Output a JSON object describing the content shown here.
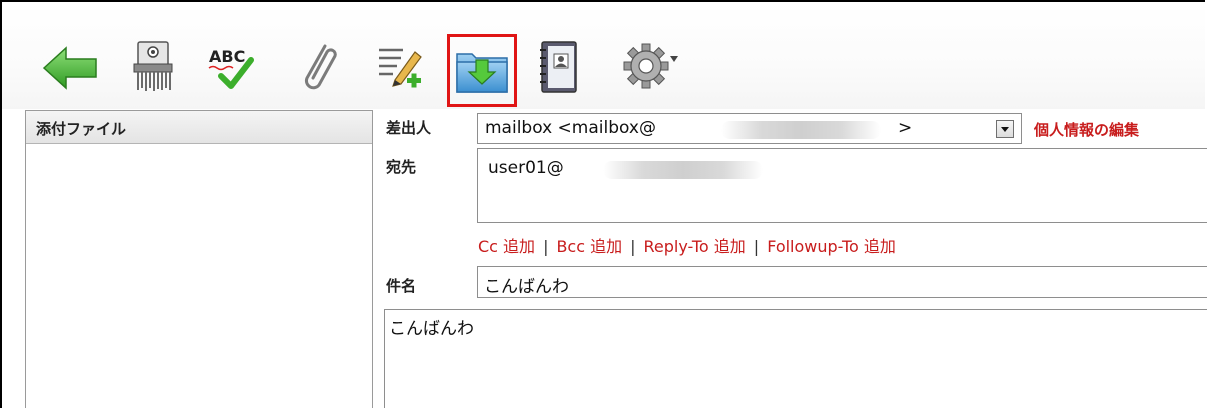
{
  "toolbar": {
    "buttons": [
      {
        "name": "back-arrow-icon"
      },
      {
        "name": "shredder-icon"
      },
      {
        "name": "spellcheck-icon",
        "text": "ABC"
      },
      {
        "name": "paperclip-icon"
      },
      {
        "name": "edit-add-icon"
      },
      {
        "name": "save-to-folder-icon"
      },
      {
        "name": "address-book-icon"
      },
      {
        "name": "gear-icon"
      }
    ],
    "colors": {
      "highlight": "#e01515",
      "arrow": "#3fb32f",
      "link": "#c81d1d"
    }
  },
  "attachments": {
    "header": "添付ファイル"
  },
  "compose": {
    "from_label": "差出人",
    "from_value_prefix": "mailbox <mailbox@",
    "from_value_suffix": ">",
    "edit_profile_link": "個人情報の編集",
    "to_label": "宛先",
    "to_value": "user01@",
    "add_links": [
      "Cc 追加",
      "Bcc 追加",
      "Reply-To 追加",
      "Followup-To 追加"
    ],
    "separator": "|",
    "subject_label": "件名",
    "subject_value": "こんばんわ",
    "body_value": "こんばんわ"
  }
}
